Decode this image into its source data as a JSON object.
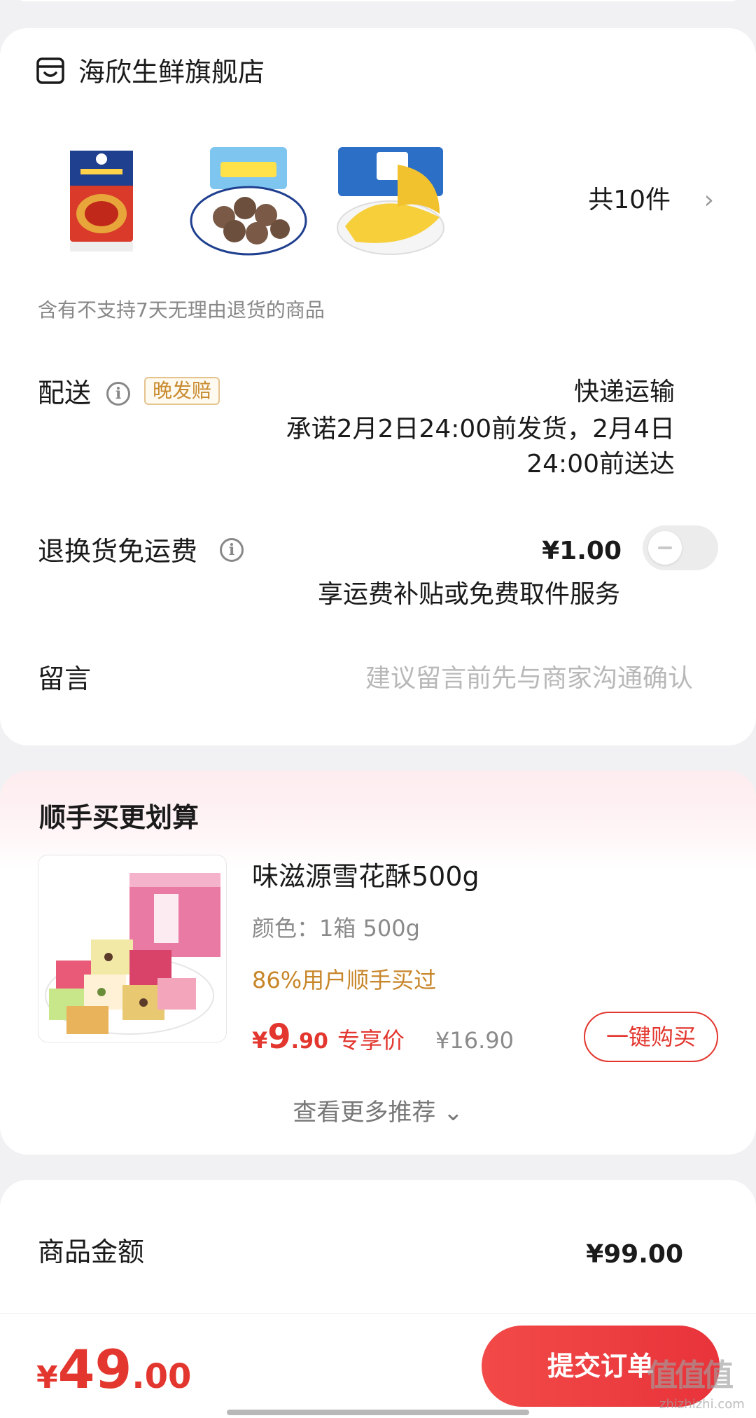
{
  "store": {
    "name": "海欣生鲜旗舰店",
    "icon": "store-icon",
    "item_count": "共10件",
    "products": [
      {
        "icon": "hotpot-base-product"
      },
      {
        "icon": "meatballs-product"
      },
      {
        "icon": "egg-dumplings-product"
      }
    ],
    "notice": "含有不支持7天无理由退货的商品"
  },
  "delivery": {
    "label": "配送",
    "badge": "晚发赔",
    "method": "快递运输",
    "promise": "承诺2月2日24:00前发货，2月4日24:00前送达"
  },
  "return_freight": {
    "label": "退换货免运费",
    "price": "¥1.00",
    "subtitle": "享运费补贴或免费取件服务",
    "enabled": false
  },
  "message": {
    "label": "留言",
    "placeholder": "建议留言前先与商家沟通确认"
  },
  "recommend": {
    "title": "顺手买更划算",
    "product_name": "味滋源雪花酥500g",
    "spec": "颜色：1箱 500g",
    "buyers": "86%用户顺手买过",
    "price_symbol": "¥",
    "price_int": "9",
    "price_dec": ".90",
    "price_tag": "专享价",
    "original_price": "¥16.90",
    "buy_label": "一键购买",
    "more_label": "查看更多推荐 ⌄"
  },
  "summary": {
    "label": "商品金额",
    "value": "¥99.00"
  },
  "bottom": {
    "total_symbol": "¥",
    "total_int": "49",
    "total_dec": ".00",
    "submit_label": "提交订单"
  },
  "watermark": {
    "main": "值值值",
    "sub": "zhizhizhi.com"
  },
  "colors": {
    "accent": "#e2362e",
    "gold": "#c8862a",
    "background": "#f1f1f3"
  }
}
